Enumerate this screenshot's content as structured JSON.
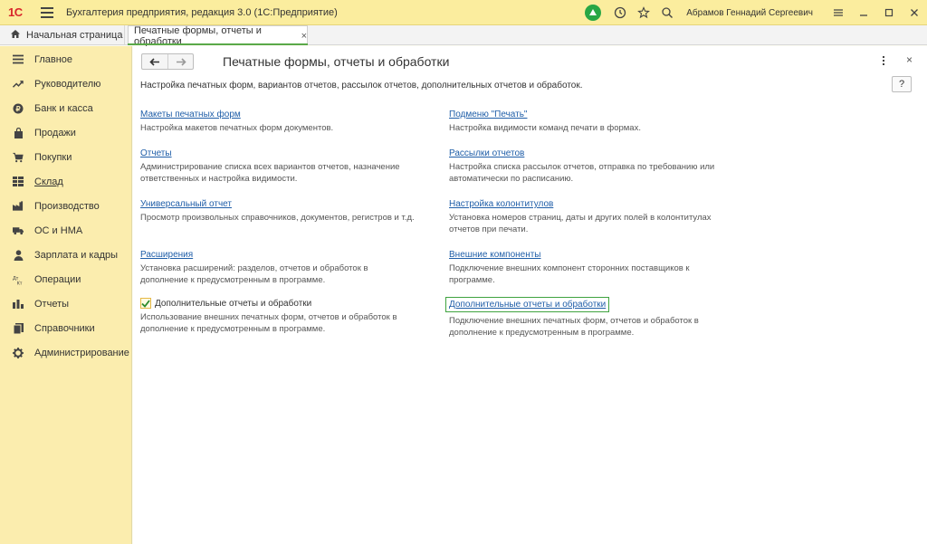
{
  "app": {
    "logo_text": "1С",
    "title": "Бухгалтерия предприятия, редакция 3.0  (1С:Предприятие)",
    "user": "Абрамов Геннадий Сергеевич"
  },
  "tabs": {
    "home_label": "Начальная страница",
    "active_label": "Печатные формы, отчеты и обработки",
    "close_glyph": "×"
  },
  "sidebar": {
    "items": [
      {
        "label": "Главное",
        "icon": "menu-icon"
      },
      {
        "label": "Руководителю",
        "icon": "trend-icon"
      },
      {
        "label": "Банк и касса",
        "icon": "coin-icon"
      },
      {
        "label": "Продажи",
        "icon": "bag-icon"
      },
      {
        "label": "Покупки",
        "icon": "cart-icon"
      },
      {
        "label": "Склад",
        "icon": "grid-icon"
      },
      {
        "label": "Производство",
        "icon": "factory-icon"
      },
      {
        "label": "ОС и НМА",
        "icon": "truck-icon"
      },
      {
        "label": "Зарплата и кадры",
        "icon": "person-icon"
      },
      {
        "label": "Операции",
        "icon": "debit-credit-icon"
      },
      {
        "label": "Отчеты",
        "icon": "bar-chart-icon"
      },
      {
        "label": "Справочники",
        "icon": "book-icon"
      },
      {
        "label": "Администрирование",
        "icon": "gear-icon"
      }
    ]
  },
  "main": {
    "title": "Печатные формы, отчеты и обработки",
    "description": "Настройка печатных форм, вариантов отчетов, рассылок отчетов, дополнительных отчетов и обработок.",
    "help_label": "?",
    "close_glyph": "×",
    "left_items": [
      {
        "link": "Макеты печатных форм",
        "desc": "Настройка макетов печатных форм документов."
      },
      {
        "link": "Отчеты",
        "desc": "Администрирование списка всех вариантов отчетов, назначение ответственных и настройка видимости."
      },
      {
        "link": "Универсальный отчет",
        "desc": "Просмотр произвольных справочников, документов, регистров и т.д."
      },
      {
        "link": "Расширения",
        "desc": "Установка расширений: разделов, отчетов и обработок в дополнение к предусмотренным в программе."
      }
    ],
    "checkbox": {
      "label": "Дополнительные отчеты и обработки",
      "checked": true,
      "desc": "Использование внешних печатных форм, отчетов и обработок в дополнение к предусмотренным в программе."
    },
    "right_items": [
      {
        "link": "Подменю \"Печать\"",
        "desc": "Настройка видимости команд печати в формах."
      },
      {
        "link": "Рассылки отчетов",
        "desc": "Настройка списка рассылок отчетов, отправка по требованию или автоматически по расписанию."
      },
      {
        "link": "Настройка колонтитулов",
        "desc": "Установка номеров страниц, даты и других полей в колонтитулах отчетов при печати."
      },
      {
        "link": "Внешние компоненты",
        "desc": "Подключение внешних компонент сторонних поставщиков к программе."
      },
      {
        "link": "Дополнительные отчеты и обработки",
        "desc": "Подключение внешних печатных форм, отчетов и обработок в дополнение к предусмотренным в программе."
      }
    ]
  },
  "colors": {
    "titlebar": "#fbed9e",
    "sidebar": "#fbedae",
    "link": "#1f5ea8",
    "accent_green": "#3fa33f"
  }
}
